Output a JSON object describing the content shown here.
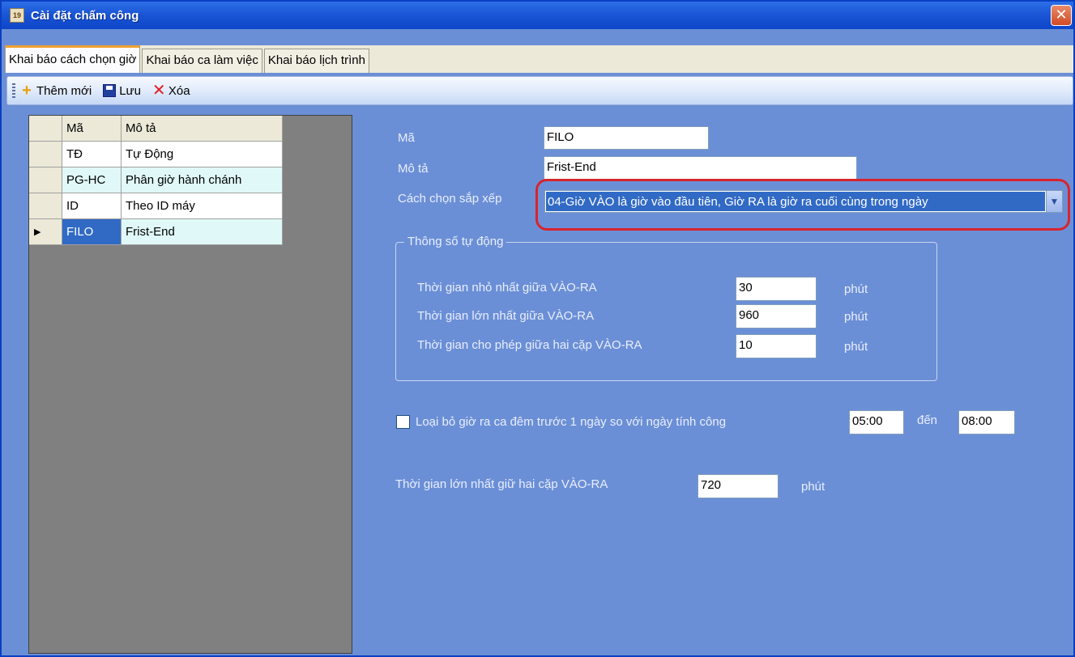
{
  "window": {
    "title": "Cài đặt chấm công",
    "app_icon": "calendar-icon",
    "close_symbol": "✕"
  },
  "tabs": [
    {
      "label": "Khai báo cách chọn giờ",
      "active": true
    },
    {
      "label": "Khai báo ca làm việc",
      "active": false
    },
    {
      "label": "Khai báo lịch trình",
      "active": false
    }
  ],
  "toolbar": {
    "add_label": "Thêm mới",
    "save_label": "Lưu",
    "delete_label": "Xóa"
  },
  "grid": {
    "headers": {
      "code": "Mã",
      "desc": "Mô tả"
    },
    "rows": [
      {
        "code": "TĐ",
        "desc": "Tự Động"
      },
      {
        "code": "PG-HC",
        "desc": "Phân giờ hành chánh"
      },
      {
        "code": "ID",
        "desc": "Theo ID máy"
      },
      {
        "code": "FILO",
        "desc": "Frist-End"
      }
    ],
    "selected_marker": "▶"
  },
  "form": {
    "code_label": "Mã",
    "code_value": "FILO",
    "desc_label": "Mô tả",
    "desc_value": "Frist-End",
    "sort_label": "Cách chọn sắp xếp",
    "sort_value": "04-Giờ VÀO là giờ vào đầu tiên, Giờ RA là giờ ra cuối cùng trong ngày"
  },
  "auto_group": {
    "title": "Thông số tự động",
    "min_label": "Thời gian nhỏ nhất giữa VÀO-RA",
    "min_value": "30",
    "max_label": "Thời gian lớn nhất giữa VÀO-RA",
    "max_value": "960",
    "gap_label": "Thời gian cho phép giữa hai cặp VÀO-RA",
    "gap_value": "10",
    "unit": "phút"
  },
  "night": {
    "checkbox_label": "Loại bỏ giờ ra ca đêm trước 1 ngày so với ngày tính công",
    "checked": false,
    "from_value": "05:00",
    "to_label": "đến",
    "to_value": "08:00"
  },
  "pair_max": {
    "label": "Thời gian lớn nhất giữ hai cặp VÀO-RA",
    "value": "720",
    "unit": "phút"
  },
  "colors": {
    "background": "#6b8fd6",
    "highlight": "#d8242c",
    "selection": "#316ac5"
  }
}
